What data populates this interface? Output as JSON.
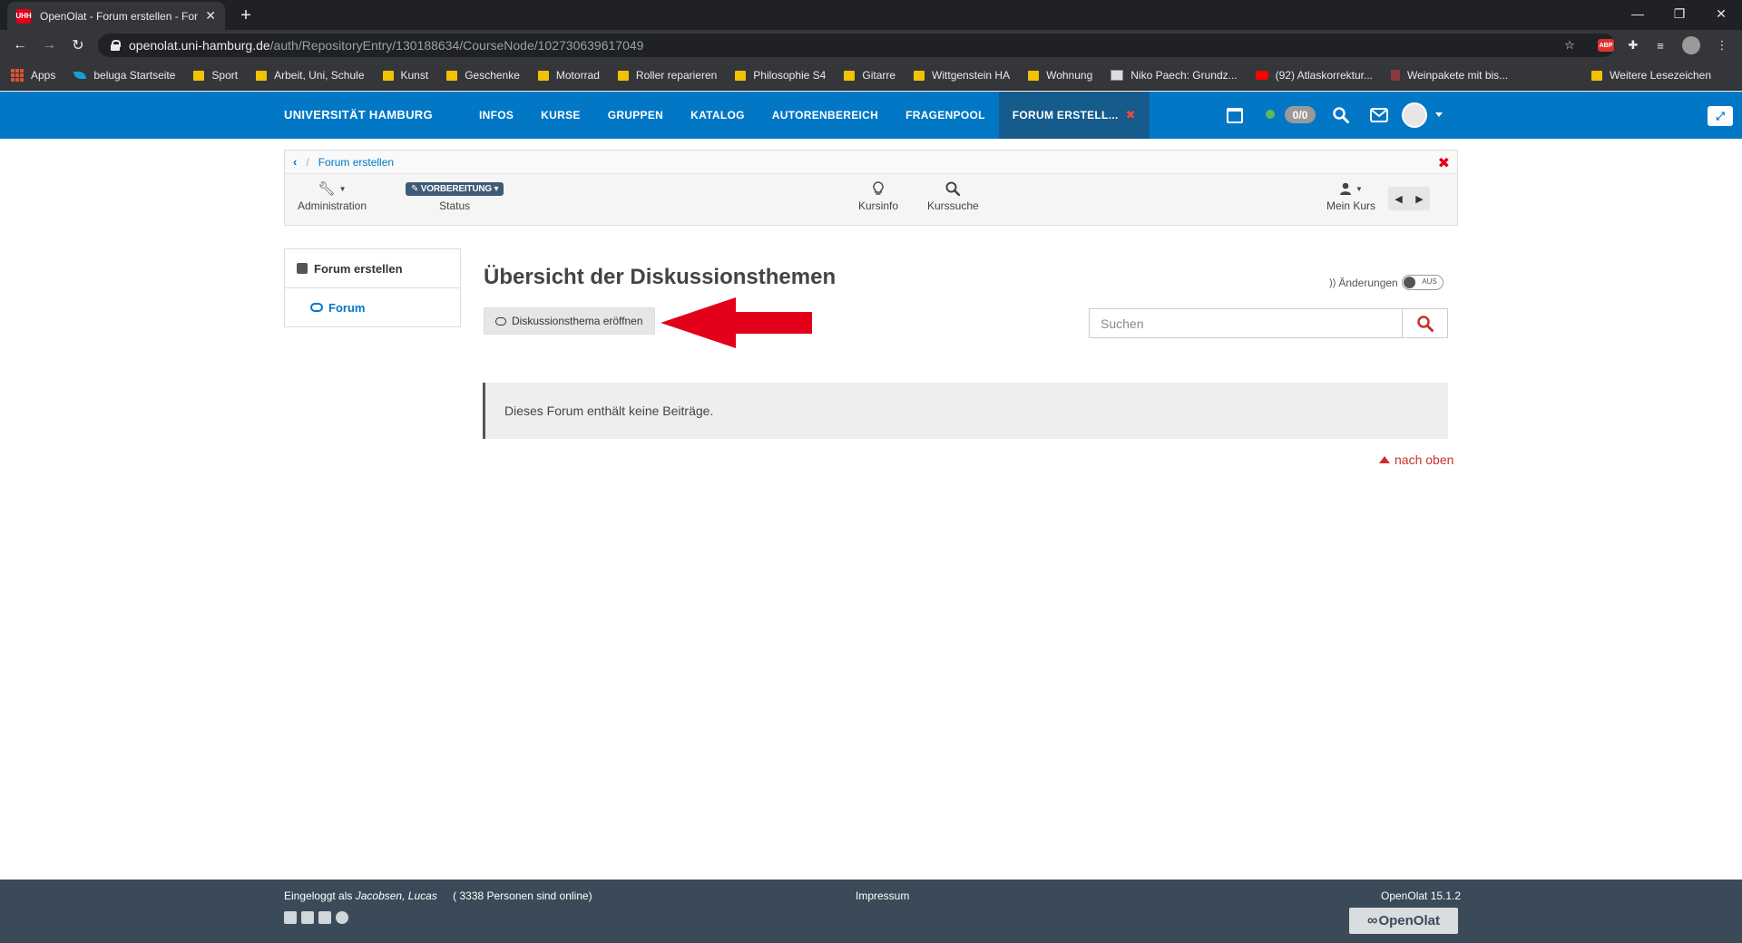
{
  "browser": {
    "tab_title": "OpenOlat - Forum erstellen - For",
    "url_host": "openolat.uni-hamburg.de",
    "url_path": "/auth/RepositoryEntry/130188634/CourseNode/102730639617049",
    "bookmarks": [
      {
        "label": "Apps",
        "icon": "apps-grid-icon"
      },
      {
        "label": "beluga Startseite",
        "icon": "beluga-icon"
      },
      {
        "label": "Sport",
        "icon": "folder-icon"
      },
      {
        "label": "Arbeit, Uni, Schule",
        "icon": "folder-icon"
      },
      {
        "label": "Kunst",
        "icon": "folder-icon"
      },
      {
        "label": "Geschenke",
        "icon": "folder-icon"
      },
      {
        "label": "Motorrad",
        "icon": "folder-icon"
      },
      {
        "label": "Roller reparieren",
        "icon": "folder-icon"
      },
      {
        "label": "Philosophie S4",
        "icon": "folder-icon"
      },
      {
        "label": "Gitarre",
        "icon": "folder-icon"
      },
      {
        "label": "Wittgenstein HA",
        "icon": "folder-icon"
      },
      {
        "label": "Wohnung",
        "icon": "folder-icon"
      },
      {
        "label": "Niko Paech: Grundz...",
        "icon": "page-icon"
      },
      {
        "label": "(92) Atlaskorrektur...",
        "icon": "youtube-icon"
      },
      {
        "label": "Weinpakete mit bis...",
        "icon": "wine-icon"
      }
    ],
    "bookmarks_more": "Weitere Lesezeichen"
  },
  "header": {
    "brand": "UNIVERSITÄT HAMBURG",
    "nav": [
      "INFOS",
      "KURSE",
      "GRUPPEN",
      "KATALOG",
      "AUTORENBEREICH",
      "FRAGENPOOL"
    ],
    "active_tab": "FORUM ERSTELL...",
    "counter": "0/0",
    "colors": {
      "bar": "#0177c6",
      "active_tab": "#155b8c",
      "online": "#5cb85c"
    }
  },
  "toolbar": {
    "breadcrumb": "Forum erstellen",
    "administration": "Administration",
    "status_badge": "VORBEREITUNG",
    "status_label": "Status",
    "kursinfo": "Kursinfo",
    "kurssuche": "Kurssuche",
    "mein_kurs": "Mein Kurs"
  },
  "leftmenu": {
    "root": "Forum erstellen",
    "child": "Forum"
  },
  "main": {
    "title": "Übersicht der Diskussionsthemen",
    "changes_label": "Änderungen",
    "toggle_state": "AUS",
    "new_topic_button": "Diskussionsthema eröffnen",
    "search_placeholder": "Suchen",
    "empty_message": "Dieses Forum enthält keine Beiträge.",
    "to_top": "nach oben",
    "arrow_color": "#e2001a"
  },
  "footer": {
    "logged_in_prefix": "Eingeloggt als",
    "user": "Jacobsen, Lucas",
    "online": "( 3338 Personen sind online)",
    "impressum": "Impressum",
    "version": "OpenOlat 15.1.2",
    "logo": "OpenOlat"
  }
}
